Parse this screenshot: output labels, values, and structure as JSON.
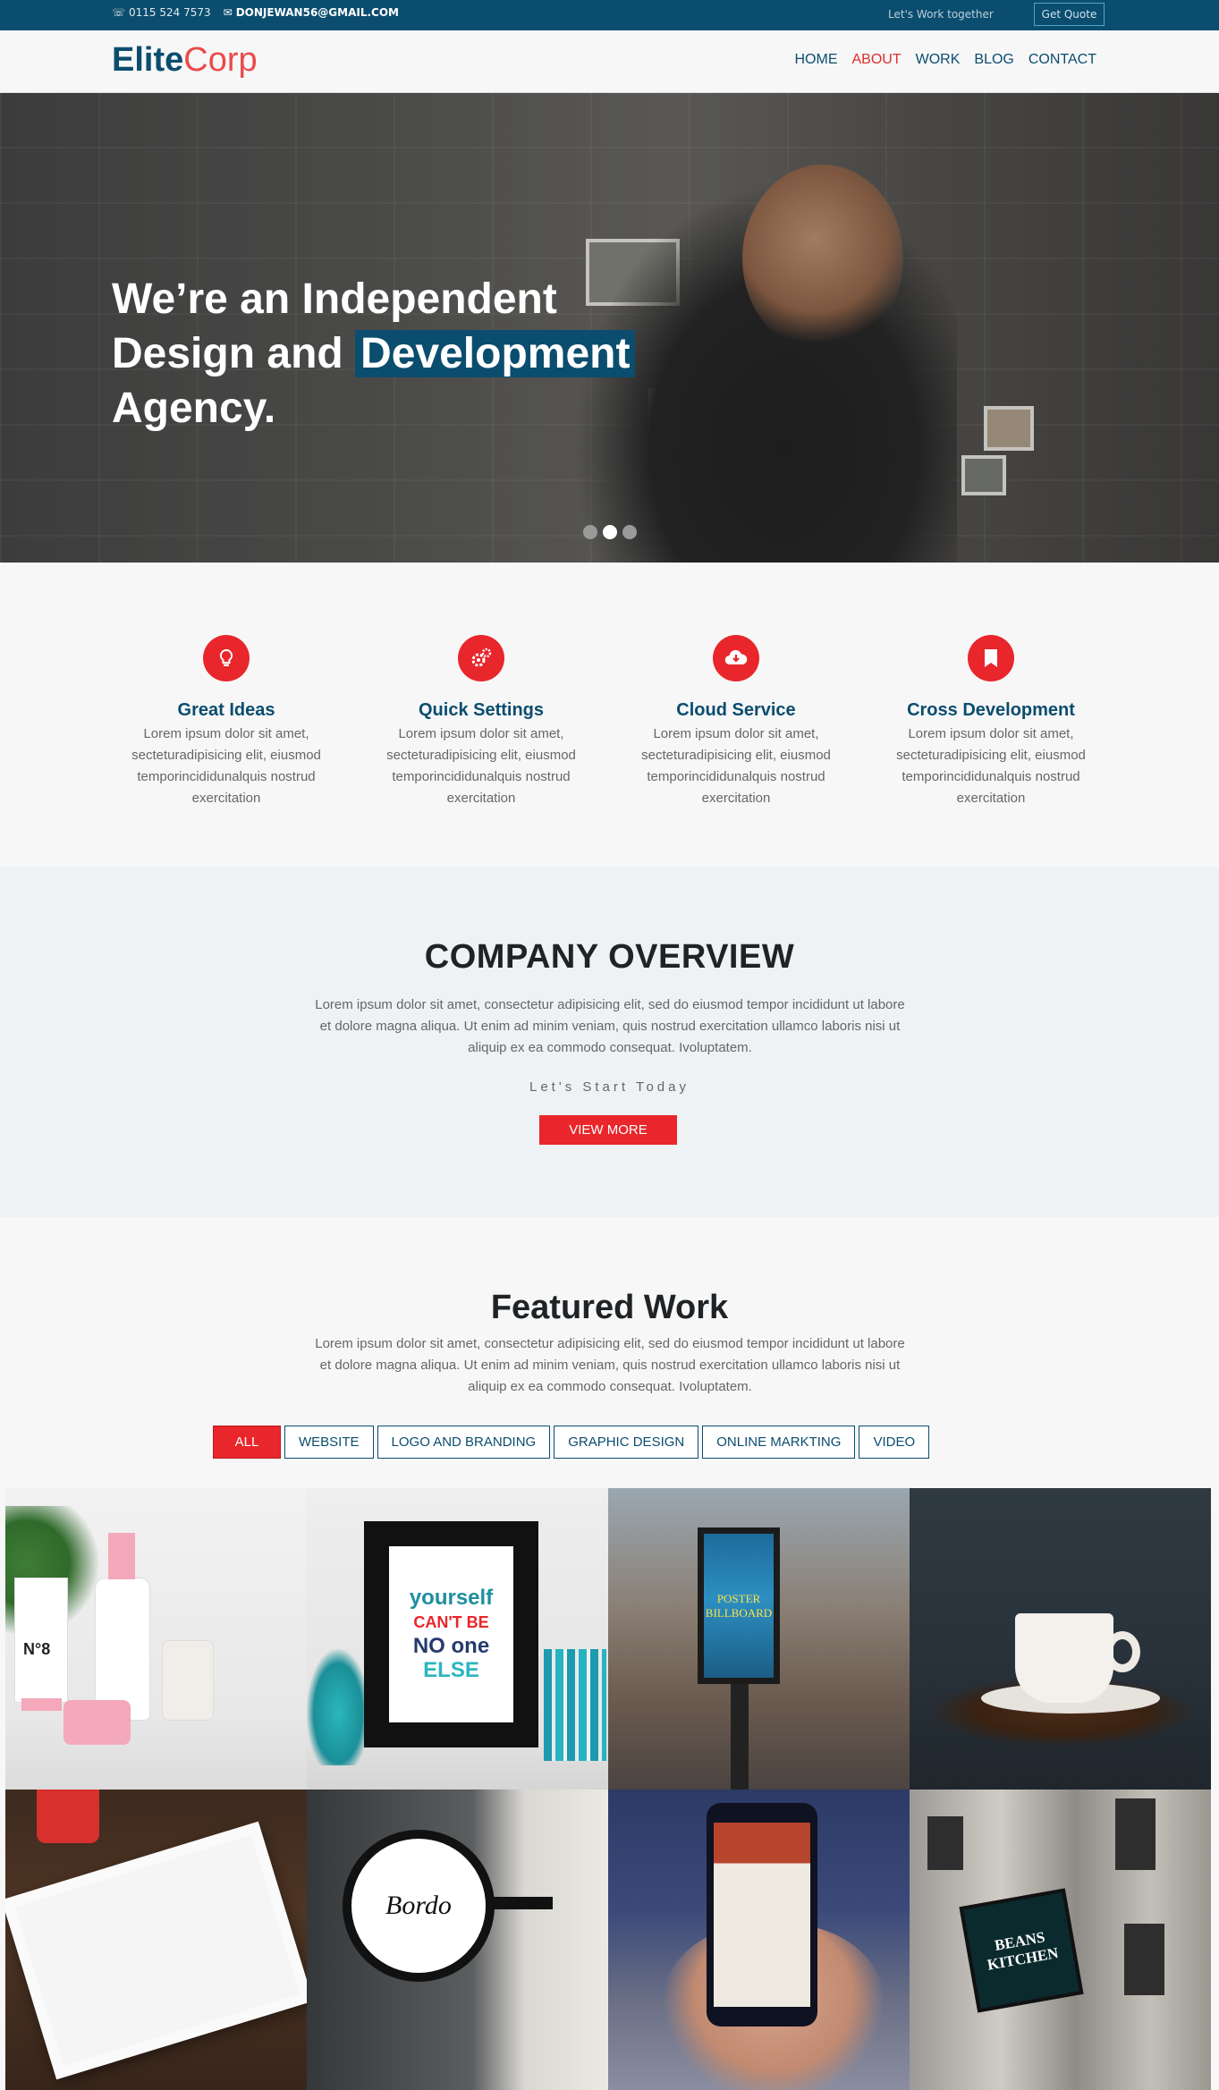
{
  "topbar": {
    "phone": "0115 524 7573",
    "email": "DONJEWAN56@GMAIL.COM",
    "tagline": "Let's Work together",
    "quote_label": "Get Quote"
  },
  "nav": {
    "logo_elite": "Elite",
    "logo_corp": "Corp",
    "items": [
      {
        "label": "HOME"
      },
      {
        "label": "ABOUT"
      },
      {
        "label": "WORK"
      },
      {
        "label": "BLOG"
      },
      {
        "label": "CONTACT"
      }
    ],
    "active": "ABOUT"
  },
  "hero": {
    "line1": "We’re an Independent",
    "line2a": "Design and",
    "line2b": "Development",
    "line3": "Agency.",
    "slide_count": 3,
    "active_slide": 2
  },
  "services": [
    {
      "icon": "lightbulb-icon",
      "title": "Great Ideas",
      "text": "Lorem ipsum dolor sit amet, secteturadipisicing elit, eiusmod temporincididunalquis nostrud exercitation"
    },
    {
      "icon": "gears-icon",
      "title": "Quick Settings",
      "text": "Lorem ipsum dolor sit amet, secteturadipisicing elit, eiusmod temporincididunalquis nostrud exercitation"
    },
    {
      "icon": "cloud-download-icon",
      "title": "Cloud Service",
      "text": "Lorem ipsum dolor sit amet, secteturadipisicing elit, eiusmod temporincididunalquis nostrud exercitation"
    },
    {
      "icon": "bookmark-icon",
      "title": "Cross Development",
      "text": "Lorem ipsum dolor sit amet, secteturadipisicing elit, eiusmod temporincididunalquis nostrud exercitation"
    }
  ],
  "overview": {
    "title": "COMPANY OVERVIEW",
    "text": "Lorem ipsum dolor sit amet, consectetur adipisicing elit, sed do eiusmod tempor incididunt ut labore et dolore magna aliqua. Ut enim ad minim veniam, quis nostrud exercitation ullamco laboris nisi ut aliquip ex ea commodo consequat. Ivoluptatem.",
    "subtitle": "Let's Start Today",
    "button": "VIEW MORE"
  },
  "featured": {
    "title": "Featured Work",
    "text": "Lorem ipsum dolor sit amet, consectetur adipisicing elit, sed do eiusmod tempor incididunt ut labore et dolore magna aliqua. Ut enim ad minim veniam, quis nostrud exercitation ullamco laboris nisi ut aliquip ex ea commodo consequat. Ivoluptatem.",
    "filters": [
      "ALL",
      "WEBSITE",
      "LOGO AND BRANDING",
      "GRAPHIC DESIGN",
      "ONLINE MARKTING",
      "VIDEO"
    ],
    "active_filter": "ALL",
    "tiles": {
      "cosmetics_label": "N°8",
      "poster_lines": [
        "yourself",
        "CAN'T BE",
        "NO one",
        "ELSE"
      ],
      "billboard_text": "POSTER BILLBOARD",
      "sign_text": "Bordo",
      "kitchen_text": "BEANS KITCHEN"
    }
  },
  "colors": {
    "brand": "#0b4d6e",
    "accent": "#e8262b"
  }
}
